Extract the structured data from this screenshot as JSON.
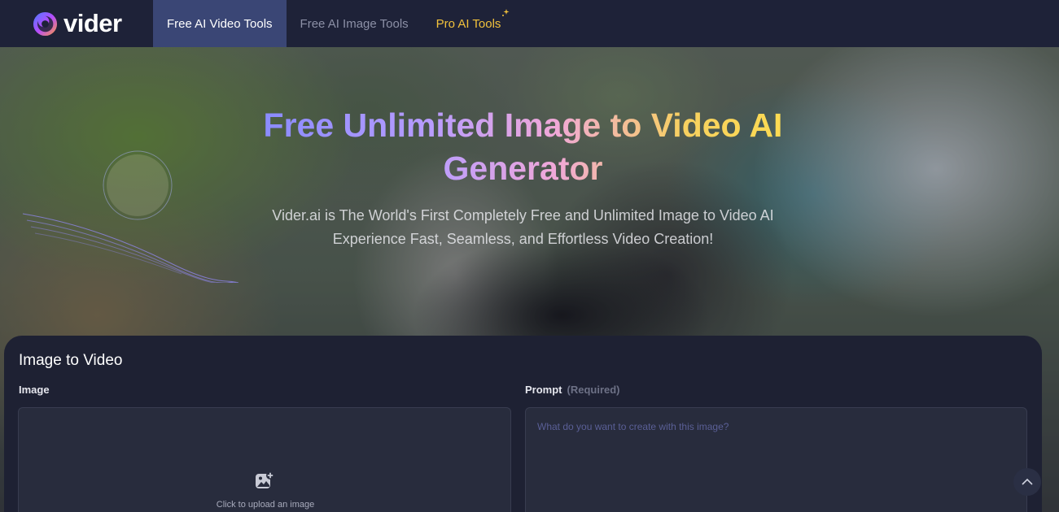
{
  "brand": {
    "name": "vider"
  },
  "nav": {
    "items": [
      {
        "label": "Free AI Video Tools",
        "active": true
      },
      {
        "label": "Free AI Image Tools",
        "active": false
      },
      {
        "label": "Pro AI Tools",
        "active": false,
        "icon": "sparkle-icon"
      }
    ]
  },
  "hero": {
    "title": "Free Unlimited Image to Video AI Generator",
    "subtitle": "Vider.ai is The World's First Completely Free and Unlimited Image to Video AI Experience Fast, Seamless, and Effortless Video Creation!"
  },
  "panel": {
    "title": "Image to Video",
    "image_label": "Image",
    "upload_text": "Click to upload an image",
    "upload_icon": "image-add-icon",
    "prompt_label": "Prompt",
    "prompt_required": "(Required)",
    "prompt_placeholder": "What do you want to create with this image?",
    "prompt_value": ""
  },
  "colors": {
    "nav_bg": "#1e2238",
    "nav_active_bg": "#3a4675",
    "pro_accent": "#f2c23c",
    "panel_bg": "#1e2133",
    "input_bg": "#282c3d"
  },
  "scroll_top": {
    "icon": "chevron-up-icon"
  }
}
